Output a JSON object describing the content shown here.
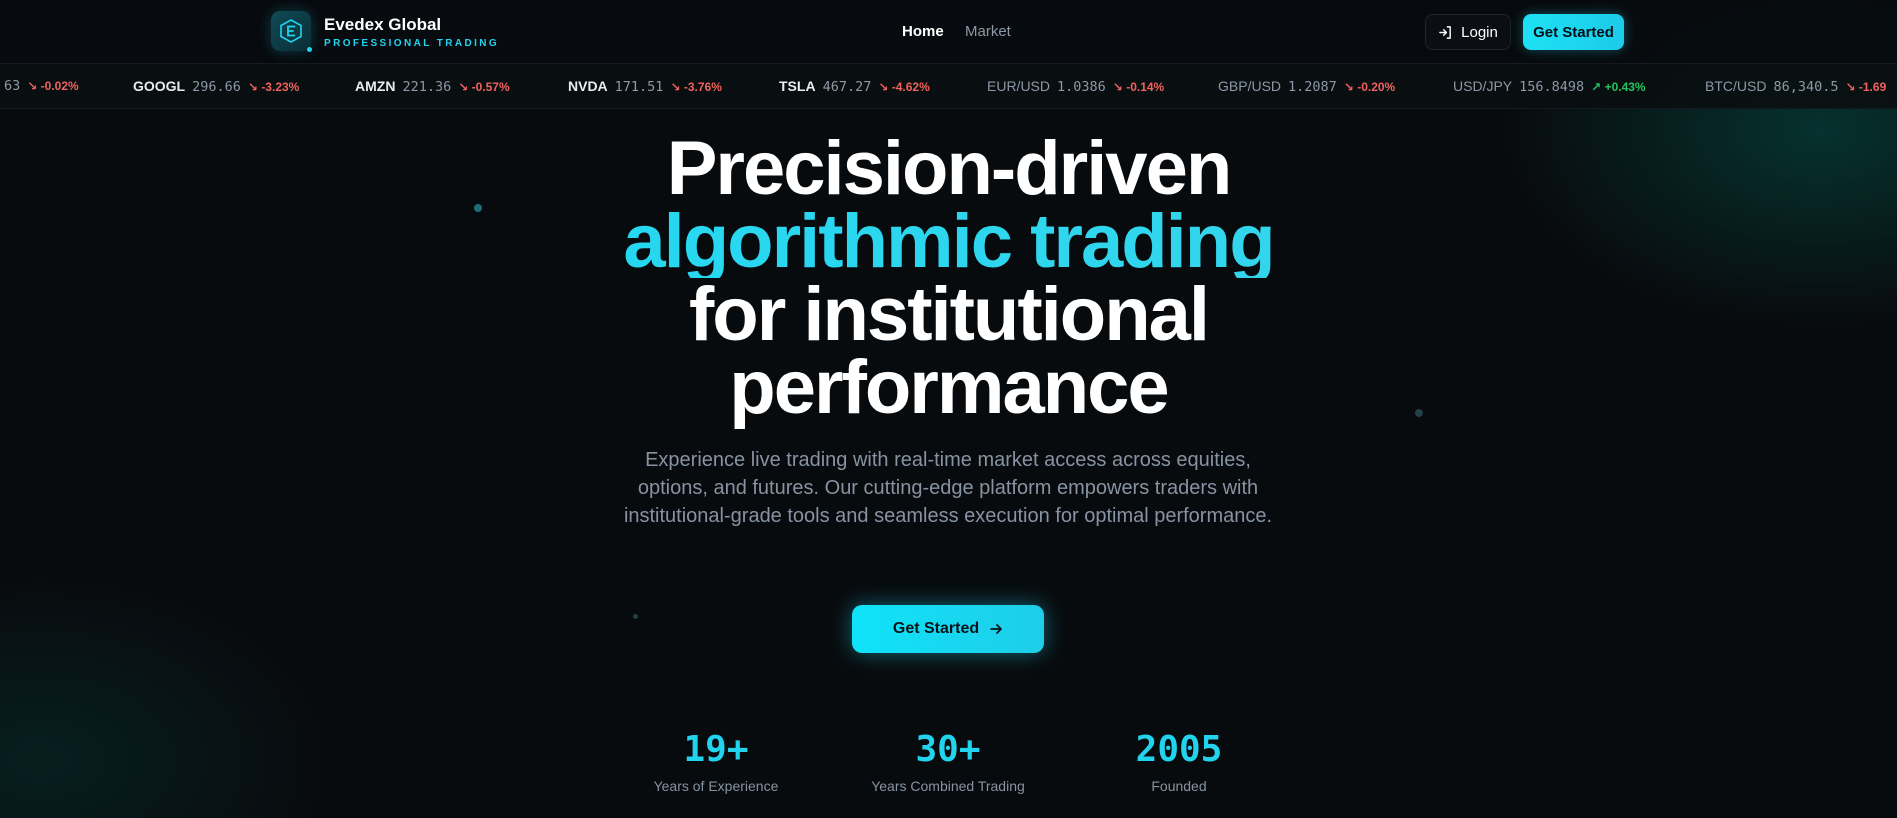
{
  "header": {
    "brand_name": "Evedex Global",
    "brand_tagline": "PROFESSIONAL TRADING",
    "nav": {
      "home": "Home",
      "market": "Market"
    },
    "login_label": "Login",
    "cta_label": "Get Started"
  },
  "ticker": [
    {
      "symbol": "",
      "price": "63",
      "change": "-0.02%",
      "direction": "down"
    },
    {
      "symbol": "GOOGL",
      "price": "296.66",
      "change": "-3.23%",
      "direction": "down"
    },
    {
      "symbol": "AMZN",
      "price": "221.36",
      "change": "-0.57%",
      "direction": "down"
    },
    {
      "symbol": "NVDA",
      "price": "171.51",
      "change": "-3.76%",
      "direction": "down"
    },
    {
      "symbol": "TSLA",
      "price": "467.27",
      "change": "-4.62%",
      "direction": "down"
    },
    {
      "symbol": "EUR/USD",
      "price": "1.0386",
      "change": "-0.14%",
      "direction": "down"
    },
    {
      "symbol": "GBP/USD",
      "price": "1.2087",
      "change": "-0.20%",
      "direction": "down"
    },
    {
      "symbol": "USD/JPY",
      "price": "156.8498",
      "change": "+0.43%",
      "direction": "up"
    },
    {
      "symbol": "BTC/USD",
      "price": "86,340.5",
      "change": "-1.69",
      "direction": "down"
    }
  ],
  "hero": {
    "title_line1": "Precision-driven",
    "title_accent": "algorithmic trading",
    "title_line3": "for institutional",
    "title_line4": "performance",
    "description": "Experience live trading with real-time market access across equities, options, and futures. Our cutting-edge platform empowers traders with institutional-grade tools and seamless execution for optimal performance.",
    "cta_label": "Get Started"
  },
  "stats": [
    {
      "value": "19+",
      "label": "Years of Experience"
    },
    {
      "value": "30+",
      "label": "Years Combined Trading"
    },
    {
      "value": "2005",
      "label": "Founded"
    }
  ],
  "colors": {
    "accent": "#22d3ee",
    "background": "#080b0e",
    "negative": "#f0625d",
    "positive": "#22c55e"
  },
  "icons": {
    "logo": "hexagon-e-logo-icon",
    "login": "sign-in-arrow-icon",
    "cta": "arrow-right-icon",
    "trend_down": "trend-down-icon",
    "trend_up": "trend-up-icon"
  }
}
